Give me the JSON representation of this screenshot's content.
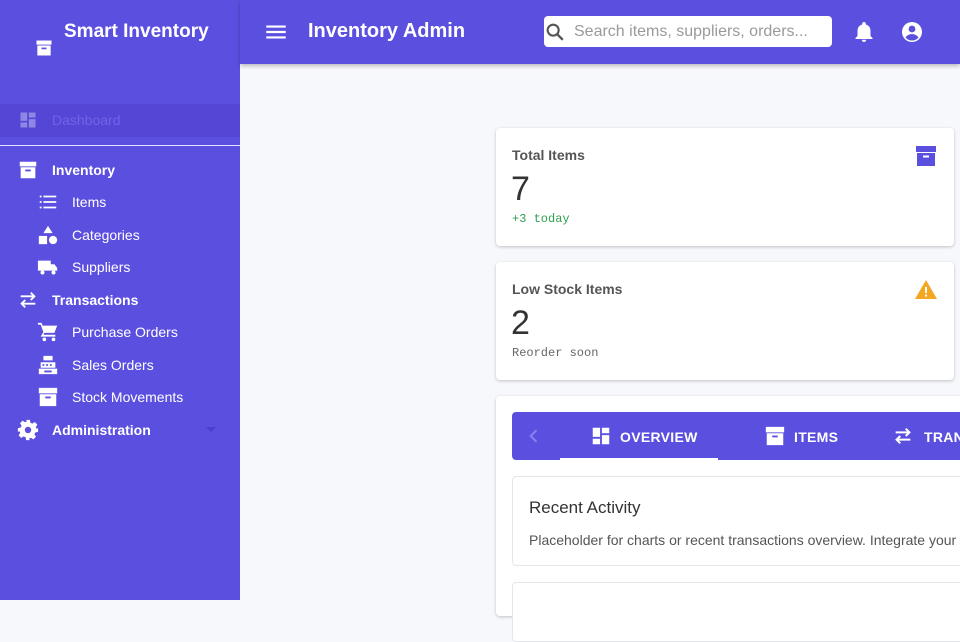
{
  "brand": {
    "name": "Smart Inventory"
  },
  "sidebar": {
    "dashboard": {
      "label": "Dashboard"
    },
    "items": [
      {
        "label": "Inventory",
        "icon": "archive-icon"
      },
      {
        "label": "Items",
        "icon": "list-icon"
      },
      {
        "label": "Categories",
        "icon": "shapes-icon"
      },
      {
        "label": "Suppliers",
        "icon": "truck-icon"
      },
      {
        "label": "Transactions",
        "icon": "swap-icon"
      },
      {
        "label": "Purchase Orders",
        "icon": "cart-icon"
      },
      {
        "label": "Sales Orders",
        "icon": "register-icon"
      },
      {
        "label": "Stock Movements",
        "icon": "archive-icon"
      },
      {
        "label": "Administration",
        "icon": "gear-icon"
      }
    ]
  },
  "header": {
    "title": "Inventory Admin",
    "search_placeholder": "Search items, suppliers, orders..."
  },
  "stats": [
    {
      "title": "Total Items",
      "value": "7",
      "sub": "+3 today",
      "icon": "archive-icon",
      "sub_color": "#2e9e4f",
      "icon_color": "#5b4fe0"
    },
    {
      "title": "Low Stock Items",
      "value": "2",
      "sub": "Reorder soon",
      "icon": "warning-icon",
      "sub_color": "#666666",
      "icon_color": "#f5a623"
    }
  ],
  "tabs": [
    {
      "label": "OVERVIEW",
      "icon": "dashboard-icon",
      "active": true
    },
    {
      "label": "ITEMS",
      "icon": "archive-icon"
    },
    {
      "label": "TRANSACTIONS",
      "icon": "swap-icon"
    }
  ],
  "panel": {
    "heading": "Recent Activity",
    "text": "Placeholder for charts or recent transactions overview. Integrate your"
  },
  "colors": {
    "primary": "#5b4fe0",
    "background": "#f7f8fc",
    "success": "#2e9e4f",
    "warning": "#f5a623"
  }
}
